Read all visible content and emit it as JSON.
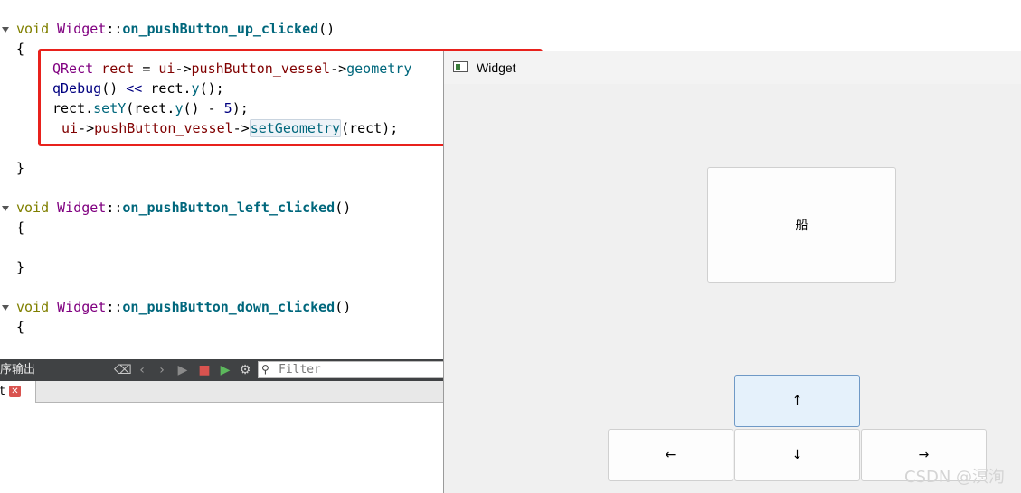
{
  "editor": {
    "fn_up": {
      "ret": "void",
      "cls": "Widget",
      "sep": "::",
      "name": "on_pushButton_up_clicked",
      "paren": "()"
    },
    "brace_open": "{",
    "brace_close": "}",
    "line1": {
      "type": "QRect",
      "var": " rect ",
      "eq": "= ",
      "ui": "ui",
      "arrow": "->",
      "member": "pushButton_vessel",
      "arrow2": "->",
      "call": "geometry"
    },
    "line2": {
      "fn": "qDebug",
      "mid": "() ",
      "op": "<<",
      "rest": " rect.",
      "call": "y",
      "end": "();"
    },
    "line3": {
      "obj": "rect.",
      "call": "setY",
      "open": "(rect.",
      "call2": "y",
      "mid": "() - ",
      "num": "5",
      "end": ");"
    },
    "line4": {
      "ui": "ui",
      "arrow": "->",
      "member": "pushButton_vessel",
      "arrow2": "->",
      "call": "setGeometry",
      "end": "(rect);"
    },
    "fn_left": {
      "ret": "void",
      "cls": "Widget",
      "sep": "::",
      "name": "on_pushButton_left_clicked",
      "paren": "()"
    },
    "fn_down": {
      "ret": "void",
      "cls": "Widget",
      "sep": "::",
      "name": "on_pushButton_down_clicked",
      "paren": "()"
    }
  },
  "output_panel": {
    "title": "序输出",
    "filter_placeholder": "Filter",
    "tab_label": "t",
    "tab_close": "✕",
    "icons": [
      "clear-icon",
      "prev-icon",
      "next-icon",
      "run-icon",
      "stop-icon",
      "rerun-icon",
      "settings-icon"
    ]
  },
  "widget_window": {
    "title": "Widget",
    "vessel_label": "船",
    "up_label": "↑",
    "left_label": "←",
    "down_label": "↓",
    "right_label": "→"
  },
  "watermark": "CSDN @溟洵",
  "colors": {
    "highlight_box": "#e8211c",
    "keyword": "#808000",
    "class": "#800080",
    "function": "#00677c",
    "variable": "#800000"
  }
}
